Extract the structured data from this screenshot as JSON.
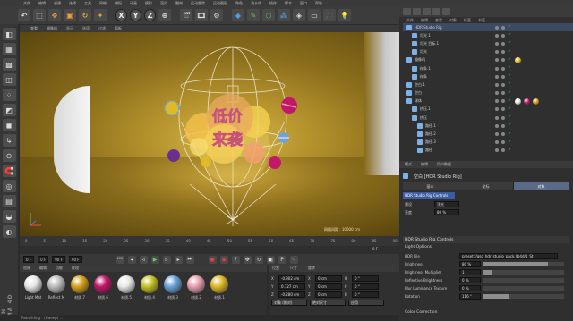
{
  "menubar": {
    "items": [
      "文件",
      "编辑",
      "创建",
      "选择",
      "工具",
      "网格",
      "捕捉",
      "动画",
      "模拟",
      "渲染",
      "雕刻",
      "运动跟踪",
      "运动图形",
      "角色",
      "流水线",
      "插件",
      "脚本",
      "窗口",
      "帮助"
    ]
  },
  "toolbar": {
    "transform_axes": [
      "X",
      "Y",
      "Z"
    ]
  },
  "viewport": {
    "menu": [
      "查看",
      "摄像机",
      "显示",
      "选项",
      "过滤",
      "面板"
    ],
    "info_text": "网格间距 : 10000 cm",
    "center_text_line1": "低价",
    "center_text_line2": "来袭"
  },
  "timeline": {
    "ticks": [
      "0",
      "5",
      "10",
      "15",
      "20",
      "25",
      "30",
      "35",
      "40",
      "45",
      "50",
      "55",
      "60",
      "65",
      "70",
      "75",
      "80",
      "85",
      "90"
    ],
    "frame_right": "0 F"
  },
  "playbar": {
    "start": "0 F",
    "current": "0 F",
    "end": "90 F",
    "end2": "90 F"
  },
  "materials": {
    "menu": [
      "创建",
      "编辑",
      "功能",
      "纹理"
    ],
    "items": [
      {
        "label": "Light Mat",
        "color": "#e8e8e8"
      },
      {
        "label": "Reflect M",
        "color": "#bdbdbd"
      },
      {
        "label": "材质.7",
        "color": "#d6a21a"
      },
      {
        "label": "材质.6",
        "color": "#c2176a"
      },
      {
        "label": "材质.5",
        "color": "#e8e8e8"
      },
      {
        "label": "材质.4",
        "color": "#c5c224"
      },
      {
        "label": "材质.3",
        "color": "#6aa4d8"
      },
      {
        "label": "材质.2",
        "color": "#e8a0b0"
      },
      {
        "label": "材质.1",
        "color": "#e0b828"
      }
    ]
  },
  "coordinates": {
    "menu": [
      "位置",
      "尺寸",
      "旋转"
    ],
    "rows": [
      {
        "axis": "X",
        "pos": "-0.902 cm",
        "size": "0 cm",
        "rot_label": "H",
        "rot": "0 °"
      },
      {
        "axis": "Y",
        "pos": "0.727 cm",
        "size": "0 cm",
        "rot_label": "P",
        "rot": "0 °"
      },
      {
        "axis": "Z",
        "pos": "-0.280 cm",
        "size": "0 cm",
        "rot_label": "B",
        "rot": "0 °"
      }
    ],
    "mode": "对象 (相对)",
    "size_mode": "绝对尺寸",
    "apply": "应用"
  },
  "object_manager": {
    "menu": [
      "文件",
      "编辑",
      "查看",
      "对象",
      "标签",
      "书签"
    ],
    "rows": [
      {
        "name": "HDR Studio Rig",
        "indent": 0,
        "selected": true,
        "tags": []
      },
      {
        "name": "灯光.1",
        "indent": 1,
        "selected": false,
        "tags": []
      },
      {
        "name": "灯光 目标.1",
        "indent": 1,
        "selected": false,
        "tags": []
      },
      {
        "name": "灯光",
        "indent": 1,
        "selected": false,
        "tags": []
      },
      {
        "name": "摄像机",
        "indent": 0,
        "selected": false,
        "tags": [
          "#e8c020"
        ]
      },
      {
        "name": "样条.1",
        "indent": 1,
        "selected": false,
        "tags": []
      },
      {
        "name": "样条",
        "indent": 1,
        "selected": false,
        "tags": []
      },
      {
        "name": "空白.1",
        "indent": 0,
        "selected": false,
        "tags": []
      },
      {
        "name": "空白",
        "indent": 0,
        "selected": false,
        "tags": []
      },
      {
        "name": "球体",
        "indent": 0,
        "selected": false,
        "tags": [
          "#e8e8e8",
          "#c2176a",
          "#d6a21a"
        ]
      },
      {
        "name": "挤压.1",
        "indent": 1,
        "selected": false,
        "tags": []
      },
      {
        "name": "挤压",
        "indent": 1,
        "selected": false,
        "tags": []
      },
      {
        "name": "路径.1",
        "indent": 2,
        "selected": false,
        "tags": []
      },
      {
        "name": "路径.2",
        "indent": 2,
        "selected": false,
        "tags": []
      },
      {
        "name": "路径.3",
        "indent": 2,
        "selected": false,
        "tags": []
      },
      {
        "name": "路径",
        "indent": 2,
        "selected": false,
        "tags": []
      }
    ]
  },
  "attribute_manager": {
    "tabs": [
      "模式",
      "编辑",
      "用户数据"
    ],
    "header": "空白 [HDR Studio Rig]",
    "subtabs": [
      "基本",
      "坐标",
      "对象"
    ],
    "controls_button": "HDR Studio Rig Controls",
    "rows": [
      {
        "label": "预设",
        "value": "顶光"
      },
      {
        "label": "亮度",
        "value": "80 %"
      }
    ],
    "section_title": "HDR Studio Rig Controls",
    "light_options": "Light Options",
    "params": [
      {
        "label": "HDR File",
        "value": "preset://gsg_hdr_studio_pack.lib4d/1_St",
        "fill": null
      },
      {
        "label": "Brightness",
        "value": "80 %",
        "fill": 0.8
      },
      {
        "label": "Brightness Multiplier",
        "value": "1",
        "fill": 0.1
      },
      {
        "label": "Reflective Brightness",
        "value": "0 %",
        "fill": 0.0
      },
      {
        "label": "Blur Luminance Texture",
        "value": "0 %",
        "fill": 0.0
      },
      {
        "label": "Rotation",
        "value": "116 °",
        "fill": 0.32
      }
    ],
    "color_correction": "Color Correction"
  },
  "status": {
    "text": "Rebuilding : (Sweep) ..."
  }
}
